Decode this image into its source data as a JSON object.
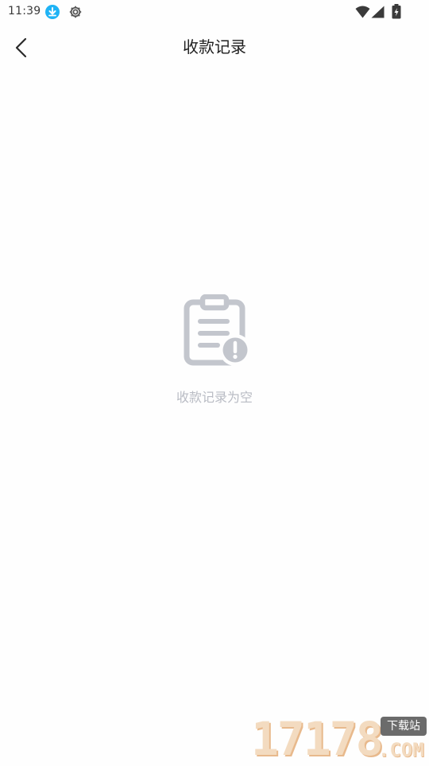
{
  "status_bar": {
    "time": "11:39",
    "icons": [
      "download-icon",
      "gear-icon",
      "wifi-icon",
      "signal-icon",
      "battery-icon"
    ]
  },
  "header": {
    "back_icon": "chevron-left-icon",
    "title": "收款记录"
  },
  "empty_state": {
    "icon": "clipboard-alert-icon",
    "message": "收款记录为空"
  },
  "watermark": {
    "digits": "17178",
    "badge": "下载站",
    "domain": ".COM"
  },
  "colors": {
    "background": "#fefefe",
    "title": "#1e1e1e",
    "empty_text": "#b9bcc4",
    "empty_icon": "#c3c6cd",
    "download_badge": "#1fb3f5"
  }
}
